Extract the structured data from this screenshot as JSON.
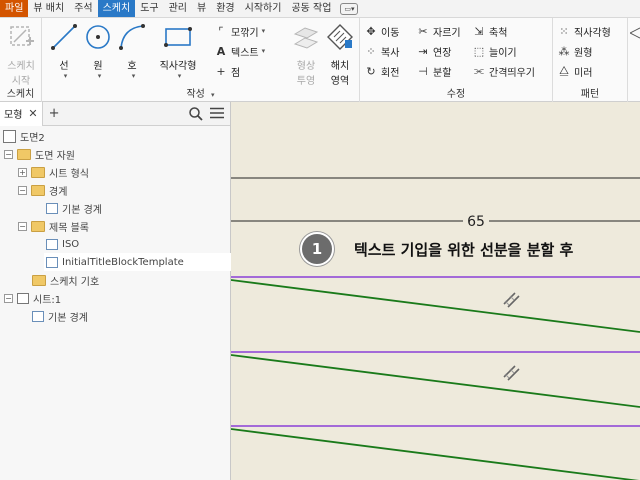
{
  "menu_tabs": [
    "파일",
    "뷰 배치",
    "주석",
    "스케치",
    "도구",
    "관리",
    "뷰",
    "환경",
    "시작하기",
    "공동 작업"
  ],
  "ribbon": {
    "sketch_panel": {
      "label": "스케치",
      "start_sketch": "스케치\n시작",
      "start_sketch_l1": "스케치",
      "start_sketch_l2": "시작"
    },
    "create_panel": {
      "label": "작성",
      "line": "선",
      "circle": "원",
      "arc": "호",
      "rectangle": "직사각형",
      "fillet": "모깎기",
      "text": "텍스트",
      "point": "점",
      "geometry_l1": "형상",
      "geometry_l2": "투영",
      "hatch_l1": "해치",
      "hatch_l2": "영역"
    },
    "modify_panel": {
      "label": "수정",
      "move": "이동",
      "copy": "복사",
      "rotate": "회전",
      "trim": "자르기",
      "extend": "연장",
      "split": "분할",
      "scale": "축척",
      "stretch": "늘이기",
      "offset": "간격띄우기"
    },
    "pattern_panel": {
      "label": "패턴",
      "rect_pattern": "직사각형",
      "circ_pattern": "원형",
      "mirror": "미러"
    }
  },
  "browser": {
    "tab_label": "모형",
    "tree": [
      "도면2",
      "도면 자원",
      "시트 형식",
      "경계",
      "기본 경계",
      "제목 블록",
      "ISO",
      "InitialTitleBlockTemplate",
      "스케치 기호",
      "시트:1",
      "기본 경계"
    ]
  },
  "canvas": {
    "dimension": "65",
    "step_number": "1",
    "instruction": "텍스트 기입을 위한 선분을 분할 후",
    "colors": {
      "background": "#eeeadc",
      "green_line": "#1a7a1a",
      "purple_line": "#8a3fd6",
      "black_line": "#222222"
    }
  }
}
